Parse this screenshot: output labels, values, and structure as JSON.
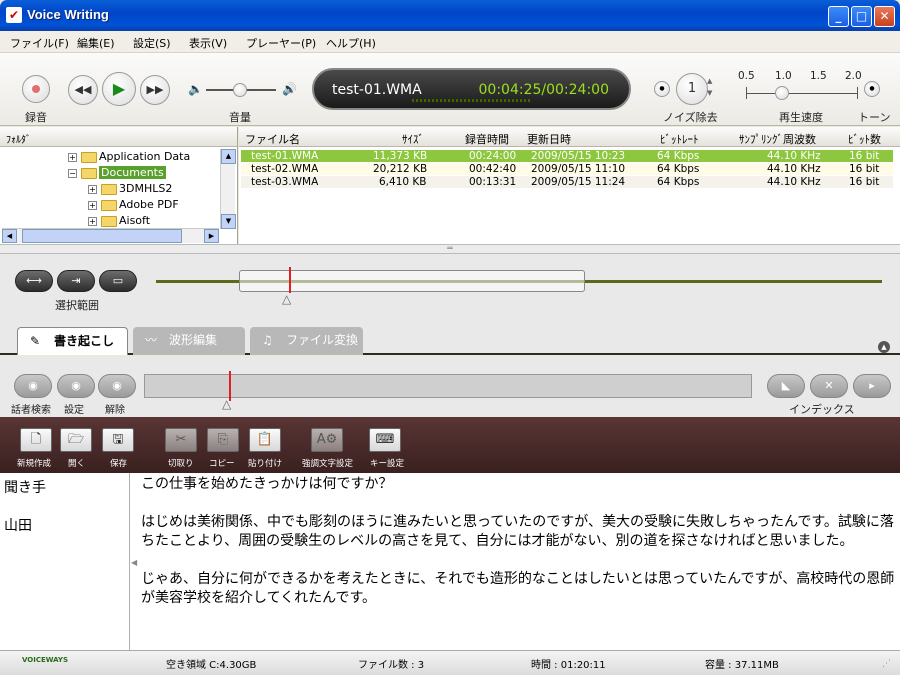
{
  "window": {
    "title": "Voice Writing"
  },
  "menu": [
    "ファイル(F)",
    "編集(E)",
    "設定(S)",
    "表示(V)",
    "プレーヤー(P)",
    "ヘルプ(H)"
  ],
  "player": {
    "record_label": "録音",
    "volume_label": "音量",
    "filename": "test-01.WMA",
    "time": "00:04:25/00:24:00",
    "noise_value": "1",
    "noise_label": "ノイズ除去",
    "speed_ticks": [
      "0.5",
      "1.0",
      "1.5",
      "2.0"
    ],
    "speed_label": "再生速度",
    "tone_label": "トーン"
  },
  "folders": {
    "header": "ﾌｫﾙﾀﾞ",
    "items": [
      "Application Data",
      "Documents",
      "3DMHLS2",
      "Adobe PDF",
      "Aisoft"
    ]
  },
  "files": {
    "columns": [
      "ファイル名",
      "ｻｲｽﾞ",
      "録音時間",
      "更新日時",
      "ﾋﾞｯﾄﾚｰﾄ",
      "ｻﾝﾌﾟﾘﾝｸﾞ周波数",
      "ﾋﾞｯﾄ数"
    ],
    "rows": [
      [
        "test-01.WMA",
        "11,373 KB",
        "00:24:00",
        "2009/05/15 10:23",
        "64 Kbps",
        "44.10 KHz",
        "16 bit"
      ],
      [
        "test-02.WMA",
        "20,212 KB",
        "00:42:40",
        "2009/05/15 11:10",
        "64 Kbps",
        "44.10 KHz",
        "16 bit"
      ],
      [
        "test-03.WMA",
        "6,410 KB",
        "00:13:31",
        "2009/05/15 11:24",
        "64 Kbps",
        "44.10 KHz",
        "16 bit"
      ]
    ]
  },
  "selection": {
    "label": "選択範囲"
  },
  "tabs": [
    "書き起こし",
    "波形編集",
    "ファイル変換"
  ],
  "index": {
    "speaker_search": "話者検索",
    "settings": "設定",
    "release": "解除",
    "index_label": "インデックス"
  },
  "edit": {
    "buttons": [
      "新規作成",
      "開く",
      "保存",
      "切取り",
      "コピー",
      "貼り付け",
      "強調文字設定",
      "キー設定"
    ]
  },
  "transcript": {
    "speakers": [
      "聞き手",
      "山田"
    ],
    "paragraphs": [
      "この仕事を始めたきっかけは何ですか？",
      "はじめは美術関係、中でも彫刻のほうに進みたいと思っていたのですが、美大の受験に失敗しちゃったんです。試験に落ちたことより、周囲の受験生のレベルの高さを見て、自分には才能がない、別の道を探さなければと思いました。",
      "じゃあ、自分に何ができるかを考えたときに、それでも造形的なことはしたいとは思っていたんですが、高校時代の恩師が美容学校を紹介してくれたんです。"
    ]
  },
  "status": {
    "logo": "VOICEWAYS",
    "free_space": "空き領域 C:4.30GB",
    "file_count": "ファイル数 : 3",
    "time": "時間 : 01:20:11",
    "capacity": "容量 : 37.11MB"
  },
  "colors": {
    "accent_green": "#8dc63f",
    "title_blue": "#0050d8",
    "editbar": "#4a2a2a"
  }
}
